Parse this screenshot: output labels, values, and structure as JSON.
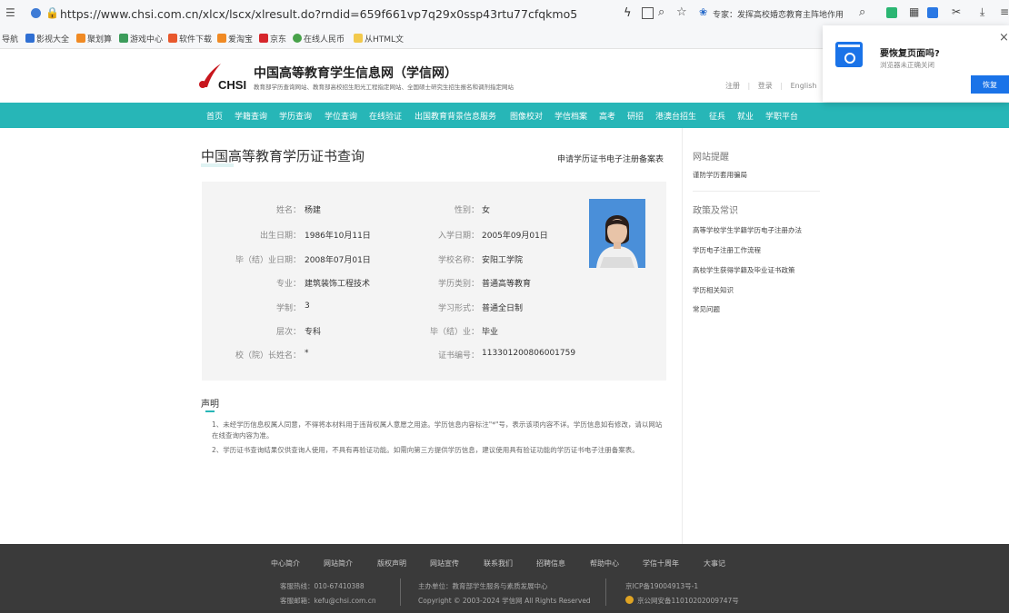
{
  "browser": {
    "url": "https://www.chsi.com.cn/xlcx/lscx/xlresult.do?rndid=659f661vp7q29x0ssp43rtu77cfqkmo5",
    "search_text": "专家：发挥高校婚恋教育主阵地作用",
    "bookmarks": [
      "导航",
      "影视大全",
      "聚划算",
      "游戏中心",
      "软件下载",
      "爱淘宝",
      "京东",
      "在线人民币",
      "从HTML文"
    ]
  },
  "header": {
    "site_title": "中国高等教育学生信息网（学信网）",
    "logo_text": "CHSI",
    "subtitle": "教育部学历查询网站、教育部高校招生阳光工程指定网站、全国硕士研究生招生报名和调剂指定网站",
    "links": [
      "注册",
      "登录",
      "English"
    ]
  },
  "nav": [
    "首页",
    "学籍查询",
    "学历查询",
    "学位查询",
    "在线验证",
    "出国教育背景信息服务",
    "图像校对",
    "学信档案",
    "高考",
    "研招",
    "港澳台招生",
    "征兵",
    "就业",
    "学职平台"
  ],
  "main": {
    "title": "中国高等教育学历证书查询",
    "apply_link": "申请学历证书电子注册备案表",
    "fields": {
      "name_label": "姓名：",
      "name": "杨建",
      "gender_label": "性别：",
      "gender": "女",
      "birth_label": "出生日期：",
      "birth": "1986年10月11日",
      "enroll_label": "入学日期：",
      "enroll": "2005年09月01日",
      "grad_label": "毕（结）业日期：",
      "grad": "2008年07月01日",
      "school_label": "学校名称：",
      "school": "安阳工学院",
      "major_label": "专业：",
      "major": "建筑装饰工程技术",
      "type_label": "学历类别：",
      "type": "普通高等教育",
      "duration_label": "学制：",
      "duration": "3",
      "form_label": "学习形式：",
      "form": "普通全日制",
      "level_label": "层次：",
      "level": "专科",
      "status_label": "毕（结）业：",
      "status": "毕业",
      "president_label": "校（院）长姓名：",
      "president": "*",
      "cert_label": "证书编号：",
      "cert": "113301200806001759"
    },
    "declaration_title": "声明",
    "declarations": [
      "1、未经学历信息权属人同意，不得将本材料用于违背权属人意愿之用途。学历信息内容标注\"*\"号，表示该项内容不详。学历信息如有修改，请以网站在线查询内容为准。",
      "2、学历证书查询结果仅供查询人使用，不具有再验证功能。如需向第三方提供学历信息，建议使用具有验证功能的学历证书电子注册备案表。"
    ]
  },
  "sidebar": {
    "tips_title": "网站提醒",
    "tips": [
      "谨防学历套用骗局"
    ],
    "policy_title": "政策及常识",
    "policies": [
      "高等学校学生学籍学历电子注册办法",
      "学历电子注册工作流程",
      "高校学生获得学籍及毕业证书政策",
      "学历相关知识",
      "常见问题"
    ]
  },
  "footer": {
    "links": [
      "中心简介",
      "网站简介",
      "版权声明",
      "网站宣传",
      "联系我们",
      "招聘信息",
      "帮助中心",
      "学信十周年",
      "大事记"
    ],
    "hotline": "客服热线：010-67410388",
    "email": "客服邮箱：kefu@chsi.com.cn",
    "host": "主办单位：教育部学生服务与素质发展中心",
    "copyright": "Copyright © 2003-2024 学信网 All Rights Reserved",
    "icp": "京ICP备19004913号-1",
    "police": "京公网安备11010202009747号"
  },
  "popup": {
    "title": "要恢复页面吗?",
    "subtitle": "浏览器未正确关闭",
    "button": "恢复"
  },
  "colors": {
    "nav": "#27b6b7",
    "footer": "#3a3a3a",
    "accent": "#1a73e8"
  }
}
